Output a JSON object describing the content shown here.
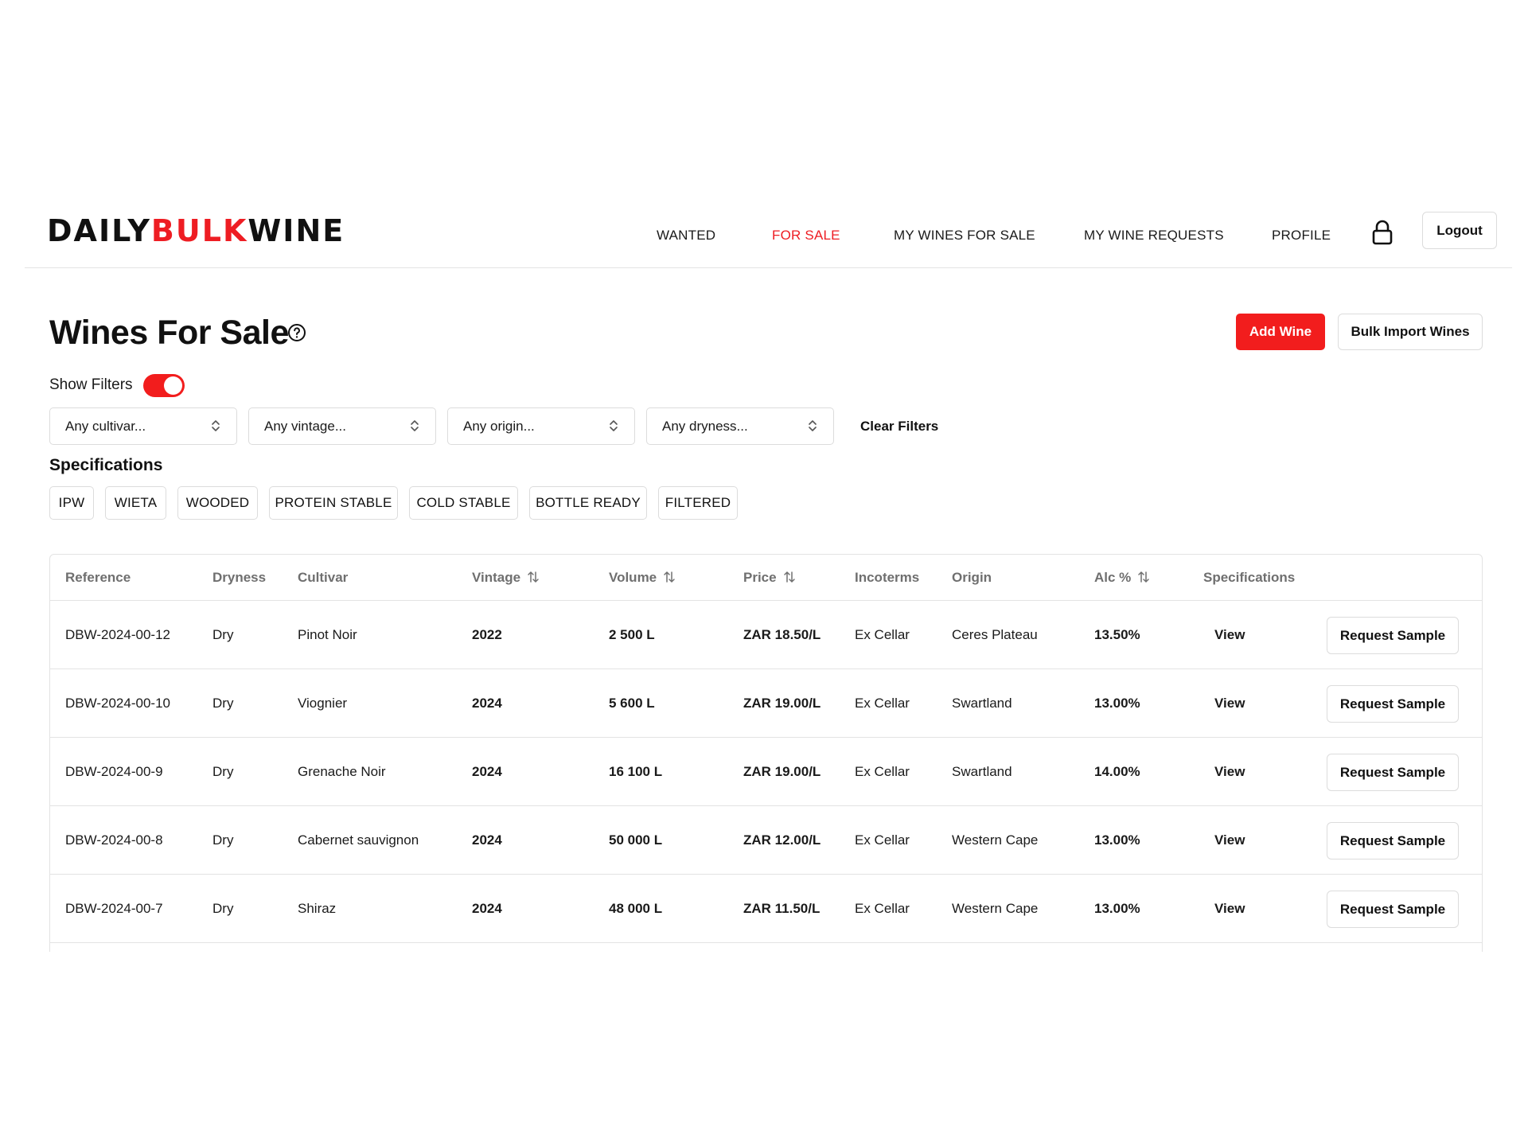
{
  "brand": {
    "part1": "DAILY",
    "part2": "BULK",
    "part3": "WINE",
    "accent_color": "#ee1d23"
  },
  "nav": {
    "items": [
      {
        "label": "WANTED",
        "active": false
      },
      {
        "label": "FOR SALE",
        "active": true
      },
      {
        "label": "MY WINES FOR SALE",
        "active": false
      },
      {
        "label": "MY WINE REQUESTS",
        "active": false
      },
      {
        "label": "PROFILE",
        "active": false
      }
    ],
    "lock_icon": "lock-icon",
    "logout_label": "Logout"
  },
  "page": {
    "title": "Wines For Sale",
    "help_icon": "help-circle-icon",
    "add_wine_label": "Add Wine",
    "bulk_import_label": "Bulk Import Wines"
  },
  "filters": {
    "show_filters_label": "Show Filters",
    "show_filters_on": true,
    "selects": [
      {
        "value": "Any cultivar..."
      },
      {
        "value": "Any vintage..."
      },
      {
        "value": "Any origin..."
      },
      {
        "value": "Any dryness..."
      }
    ],
    "clear_label": "Clear Filters"
  },
  "specifications": {
    "title": "Specifications",
    "chips": [
      "IPW",
      "WIETA",
      "WOODED",
      "PROTEIN STABLE",
      "COLD STABLE",
      "BOTTLE READY",
      "FILTERED"
    ]
  },
  "table": {
    "columns": [
      {
        "label": "Reference",
        "sortable": false
      },
      {
        "label": "Dryness",
        "sortable": false
      },
      {
        "label": "Cultivar",
        "sortable": false
      },
      {
        "label": "Vintage",
        "sortable": true
      },
      {
        "label": "Volume",
        "sortable": true
      },
      {
        "label": "Price",
        "sortable": true
      },
      {
        "label": "Incoterms",
        "sortable": false
      },
      {
        "label": "Origin",
        "sortable": false
      },
      {
        "label": "Alc %",
        "sortable": true
      },
      {
        "label": "Specifications",
        "sortable": false
      }
    ],
    "view_label": "View",
    "request_sample_label": "Request Sample",
    "rows": [
      {
        "reference": "DBW-2024-00-12",
        "dryness": "Dry",
        "cultivar": "Pinot Noir",
        "vintage": "2022",
        "volume": "2 500 L",
        "price": "ZAR 18.50/L",
        "incoterms": "Ex Cellar",
        "origin": "Ceres Plateau",
        "alc": "13.50%"
      },
      {
        "reference": "DBW-2024-00-10",
        "dryness": "Dry",
        "cultivar": "Viognier",
        "vintage": "2024",
        "volume": "5 600 L",
        "price": "ZAR 19.00/L",
        "incoterms": "Ex Cellar",
        "origin": "Swartland",
        "alc": "13.00%"
      },
      {
        "reference": "DBW-2024-00-9",
        "dryness": "Dry",
        "cultivar": "Grenache Noir",
        "vintage": "2024",
        "volume": "16 100 L",
        "price": "ZAR 19.00/L",
        "incoterms": "Ex Cellar",
        "origin": "Swartland",
        "alc": "14.00%"
      },
      {
        "reference": "DBW-2024-00-8",
        "dryness": "Dry",
        "cultivar": "Cabernet sauvignon",
        "vintage": "2024",
        "volume": "50 000 L",
        "price": "ZAR 12.00/L",
        "incoterms": "Ex Cellar",
        "origin": "Western Cape",
        "alc": "13.00%"
      },
      {
        "reference": "DBW-2024-00-7",
        "dryness": "Dry",
        "cultivar": "Shiraz",
        "vintage": "2024",
        "volume": "48 000 L",
        "price": "ZAR 11.50/L",
        "incoterms": "Ex Cellar",
        "origin": "Western Cape",
        "alc": "13.00%"
      }
    ]
  }
}
